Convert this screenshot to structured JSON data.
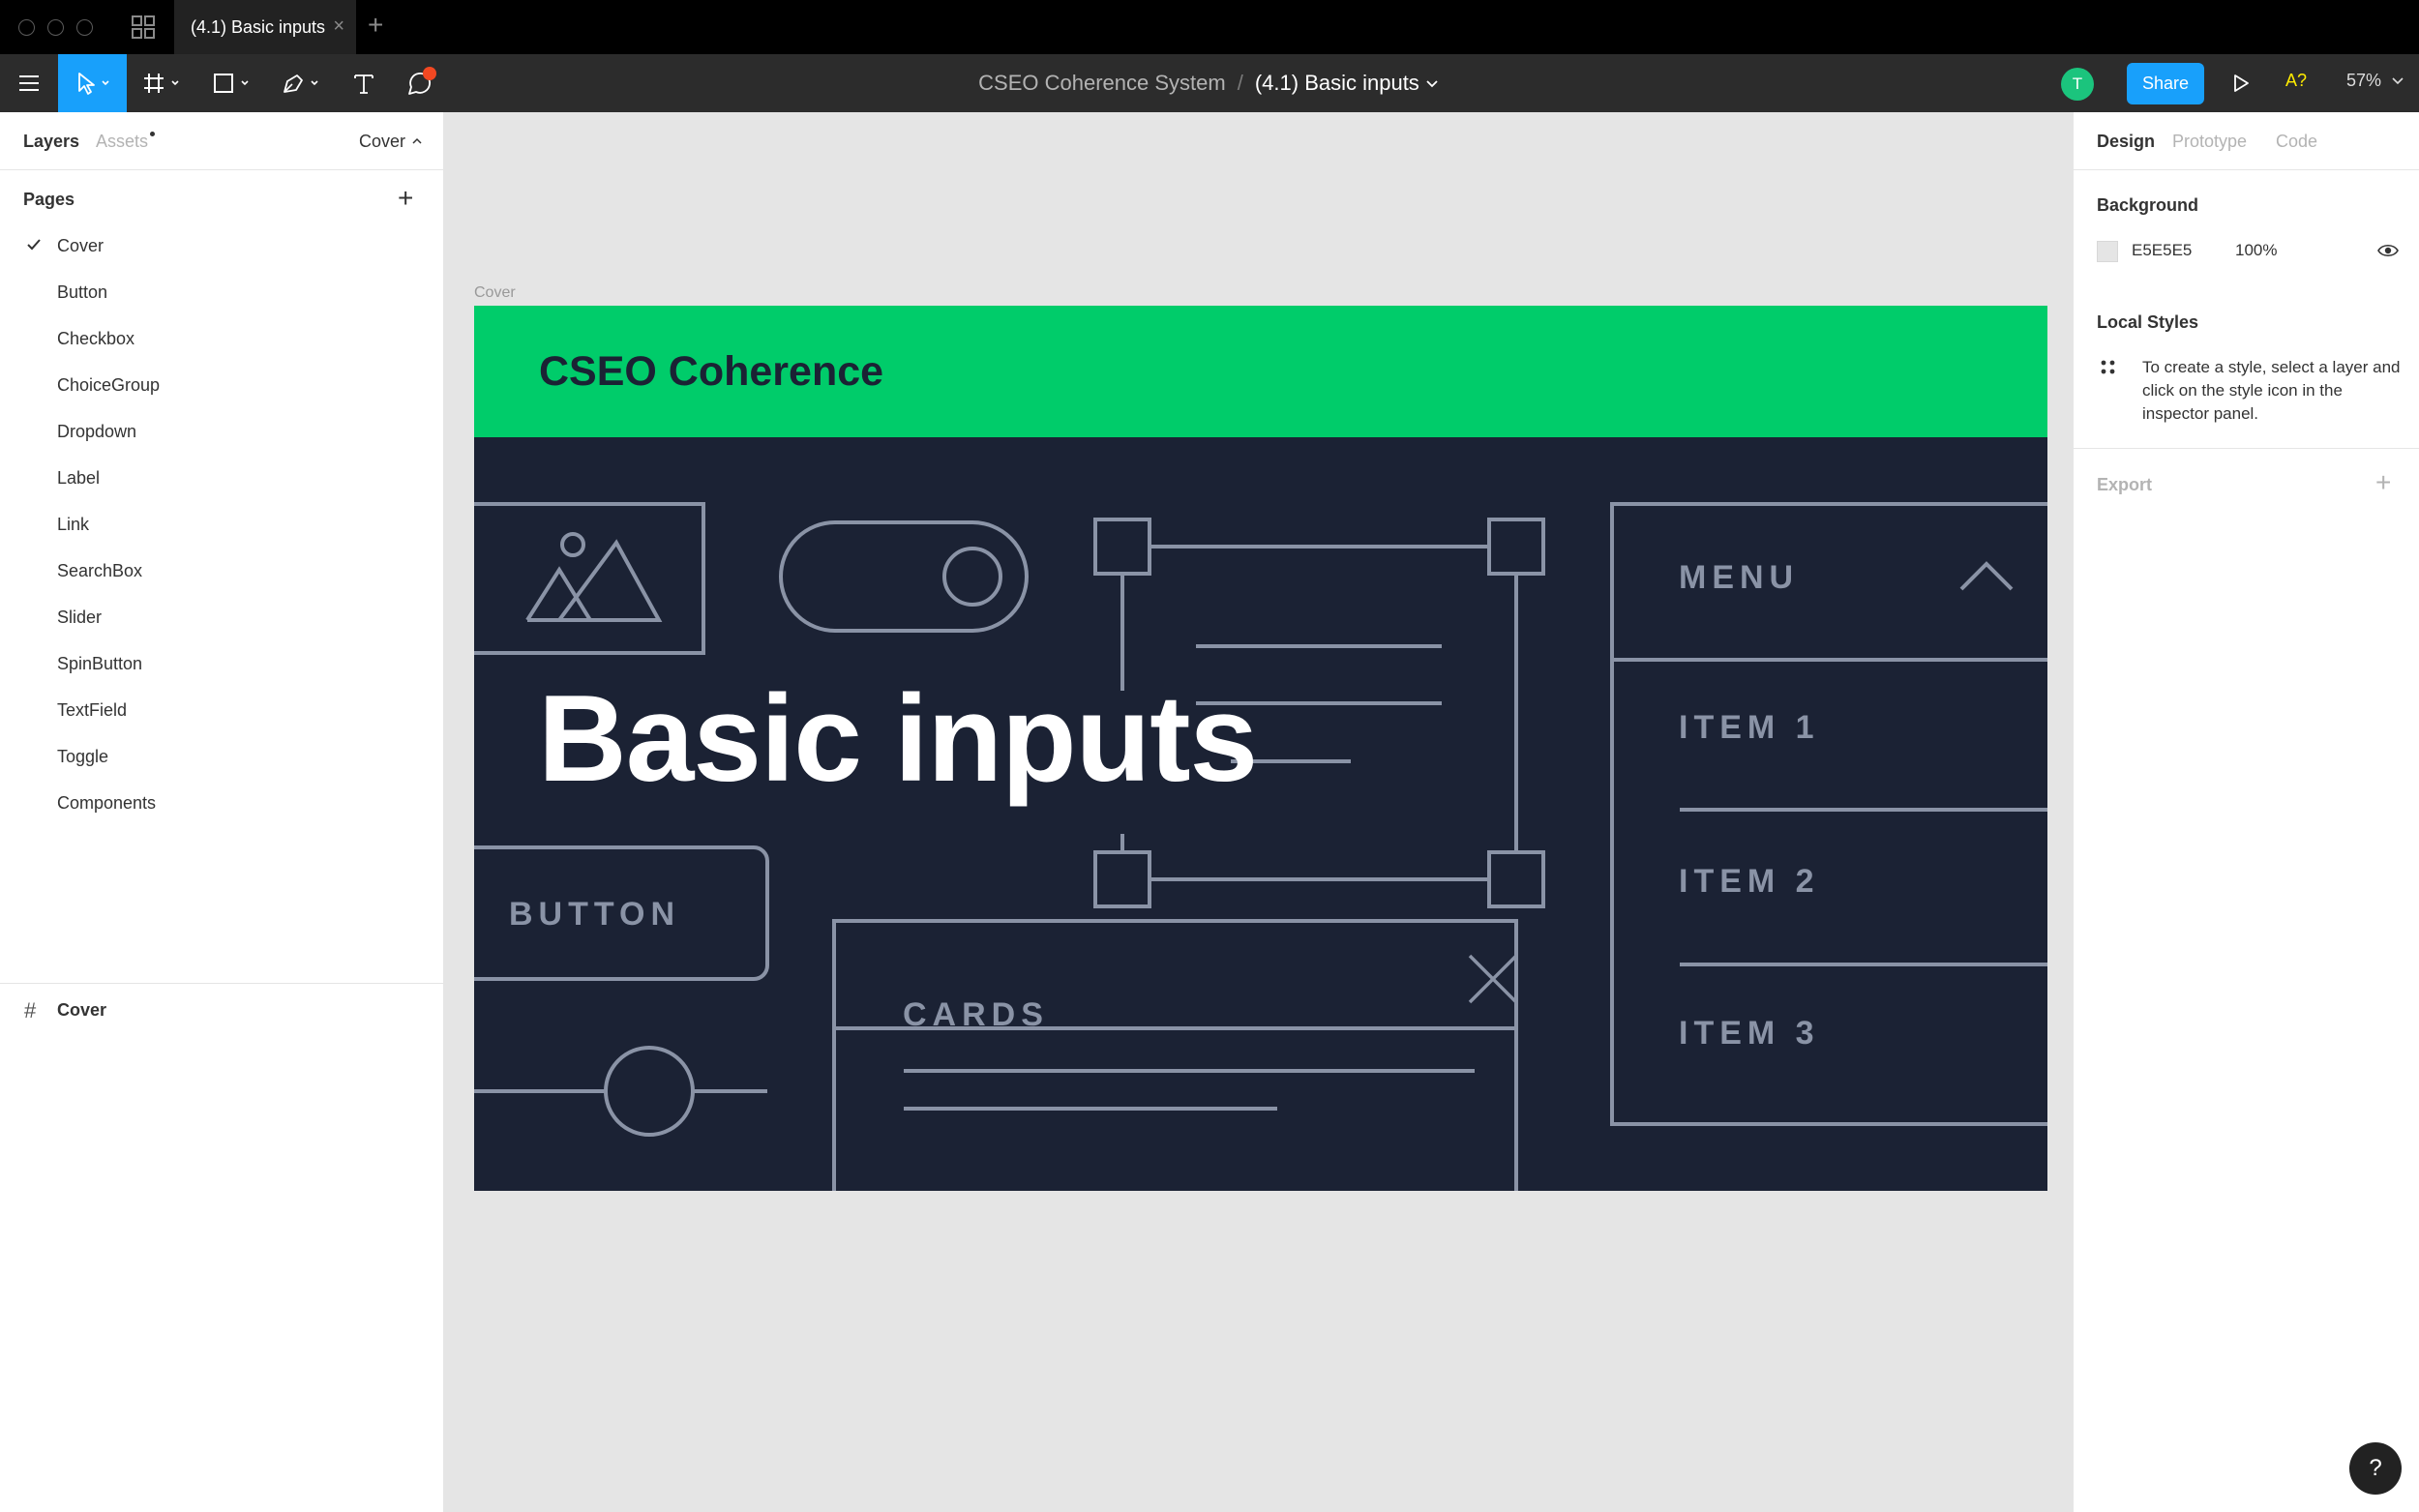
{
  "window": {
    "tab_title": "(4.1) Basic inputs",
    "tab_close": "×",
    "new_tab": "+"
  },
  "toolbar": {
    "project": "CSEO Coherence System",
    "separator": "/",
    "file": "(4.1) Basic inputs",
    "avatar_initial": "T",
    "share_label": "Share",
    "accessibility_label": "A?",
    "zoom": "57%"
  },
  "left_panel": {
    "tab_layers": "Layers",
    "tab_assets": "Assets",
    "page_selector": "Cover",
    "pages_title": "Pages",
    "pages": [
      "Cover",
      "Button",
      "Checkbox",
      "ChoiceGroup",
      "Dropdown",
      "Label",
      "Link",
      "SearchBox",
      "Slider",
      "SpinButton",
      "TextField",
      "Toggle",
      "Components"
    ],
    "current_page": "Cover",
    "layers": [
      {
        "name": "Cover",
        "type": "frame"
      }
    ]
  },
  "right_panel": {
    "tabs": [
      "Design",
      "Prototype",
      "Code"
    ],
    "active_tab": "Design",
    "background_title": "Background",
    "background_hex": "E5E5E5",
    "background_opacity": "100%",
    "local_styles_title": "Local Styles",
    "local_styles_hint": "To create a style, select a layer and click on the style icon in the inspector panel.",
    "export_title": "Export"
  },
  "canvas": {
    "frame_label": "Cover",
    "brand": "CSEO Coherence",
    "title": "Basic inputs",
    "wire_labels": {
      "menu": "MENU",
      "item1": "ITEM 1",
      "item2": "ITEM 2",
      "item3": "ITEM 3",
      "button": "BUTTON",
      "cards": "CARDS"
    }
  },
  "help_label": "?",
  "colors": {
    "accent": "#18a0fb",
    "brand_green": "#00cc6a",
    "frame_bg": "#1b2234",
    "wire": "#8a93a6"
  }
}
